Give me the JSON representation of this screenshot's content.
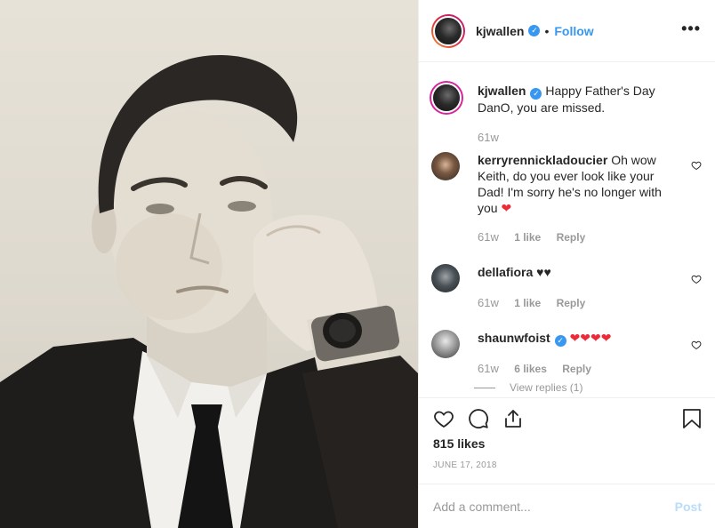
{
  "header": {
    "username": "kjwallen",
    "verified_mark": "✓",
    "separator": "•",
    "follow_label": "Follow",
    "more_label": "•••"
  },
  "caption": {
    "username": "kjwallen",
    "text": "Happy Father's Day DanO, you are missed.",
    "age": "61w"
  },
  "comments": [
    {
      "username": "kerryrennickladoucier",
      "text": "Oh wow Keith, do you ever look like your Dad! I'm sorry he's no longer with you",
      "emoji": "❤",
      "age": "61w",
      "likes": "1 like",
      "reply": "Reply"
    },
    {
      "username": "dellafiora",
      "text": "",
      "emoji": "♥♥",
      "age": "61w",
      "likes": "1 like",
      "reply": "Reply"
    },
    {
      "username": "shaunwfoist",
      "text": "",
      "emoji": "❤❤❤❤",
      "age": "61w",
      "likes": "6 likes",
      "reply": "Reply",
      "view_replies": "View replies (1)"
    }
  ],
  "stats": {
    "likes": "815 likes",
    "date": "JUNE 17, 2018"
  },
  "composer": {
    "placeholder": "Add a comment...",
    "post_label": "Post"
  },
  "colors": {
    "accent": "#3897f0",
    "heart_red": "#ed2a38",
    "muted": "#999999"
  },
  "icons": [
    "heart-icon",
    "comment-icon",
    "share-icon",
    "bookmark-icon",
    "more-icon",
    "verified-icon"
  ]
}
